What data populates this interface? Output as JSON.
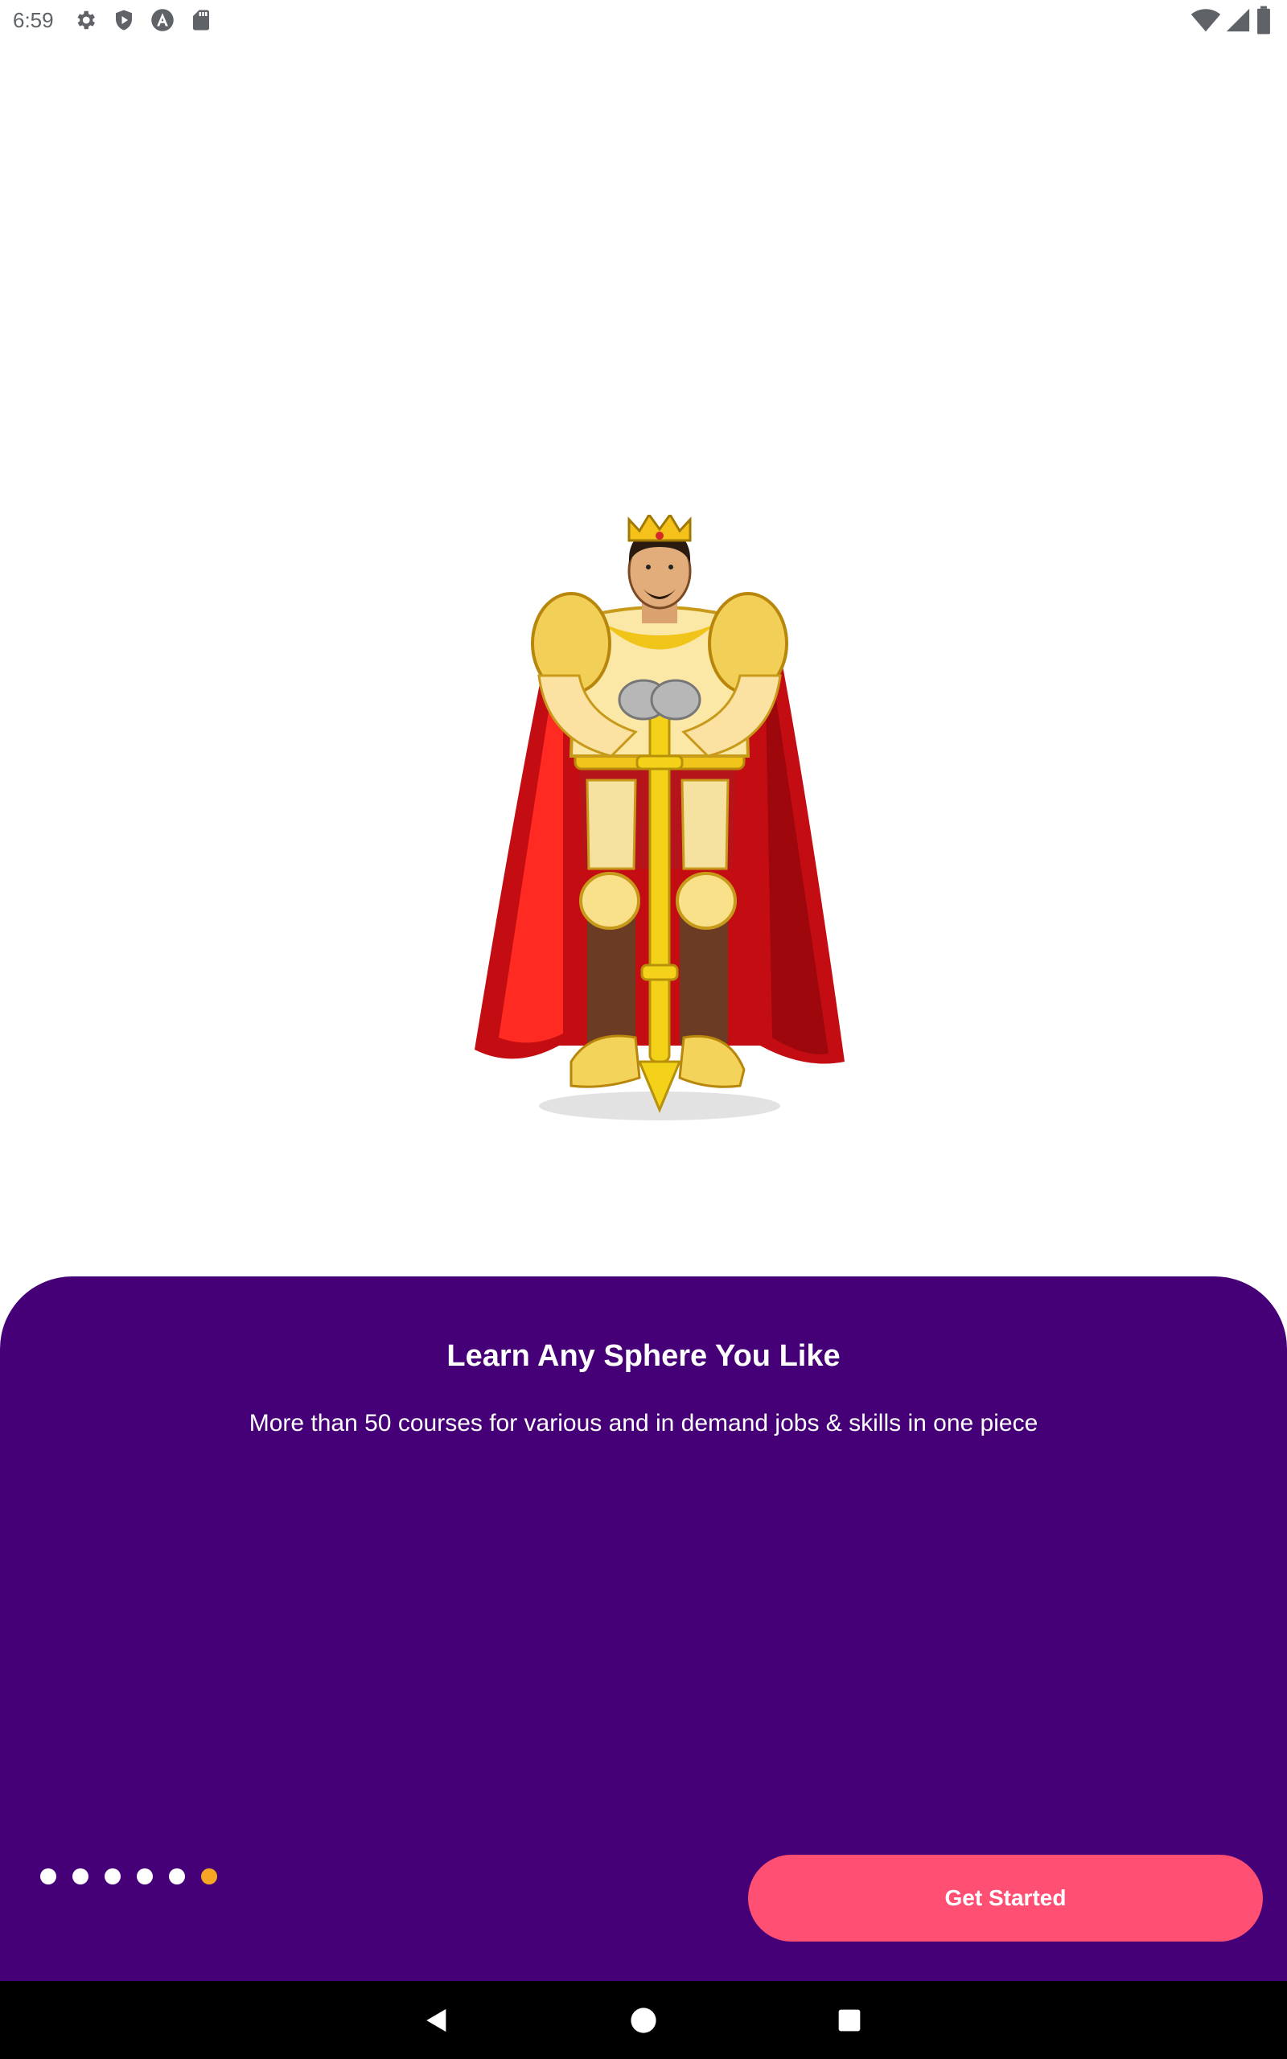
{
  "status_bar": {
    "time": "6:59",
    "left_icons": [
      "gear-icon",
      "shield-play-icon",
      "a-badge-icon",
      "sd-card-icon"
    ],
    "right_icons": [
      "wifi-icon",
      "signal-icon",
      "battery-icon"
    ]
  },
  "illustration": {
    "name": "king-illustration"
  },
  "onboarding": {
    "title": "Learn Any Sphere You Like",
    "subtitle": "More than 50 courses for various and in demand jobs & skills in one piece",
    "page_count": 6,
    "active_page": 6,
    "cta_label": "Get Started"
  },
  "colors": {
    "sheet_background": "#460077",
    "cta_background": "#ff4f73",
    "active_dot": "#f6a623",
    "inactive_dot": "#ffffff"
  },
  "nav_bar": {
    "buttons": [
      "back-icon",
      "home-icon",
      "recents-icon"
    ]
  }
}
